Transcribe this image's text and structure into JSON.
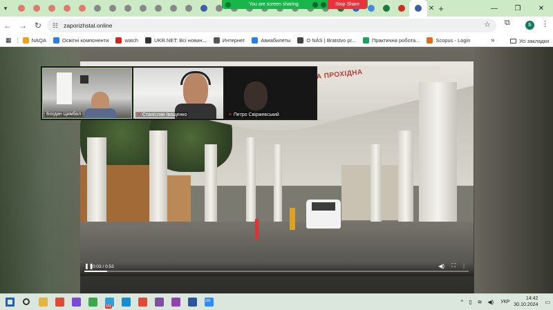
{
  "browser": {
    "tab_count": 28,
    "new_tab_symbol": "+",
    "close_symbol": "✕",
    "window_controls": [
      "—",
      "❐",
      "✕"
    ],
    "tab_colors": [
      "#e07a6a",
      "#e07a6a",
      "#e07a6a",
      "#e07a6a",
      "#e07a6a",
      "#888888",
      "#888888",
      "#888888",
      "#888888",
      "#888888",
      "#888888",
      "#888888",
      "#3d5fa8",
      "#888888",
      "#888888",
      "#888888",
      "#888888",
      "#888888",
      "#888888",
      "#888888",
      "#888888",
      "#1e7a3c",
      "#1f6fd1",
      "#4a8bd8",
      "#1e7a3c",
      "#c8331f",
      "#3a5ea8"
    ]
  },
  "share_banner": {
    "text": "You are screen sharing",
    "stop_label": "Stop Share"
  },
  "toolbar": {
    "url": "zaporizhstal.online",
    "profile_letter": "Б"
  },
  "bookmarks": {
    "items": [
      {
        "label": "NAQA",
        "icon_color": "#f0a020"
      },
      {
        "label": "Освітні компоненти",
        "icon_color": "#2a7de1"
      },
      {
        "label": "watch",
        "icon_color": "#e02020"
      },
      {
        "label": "UKR.NET: Всі новин...",
        "icon_color": "#333333"
      },
      {
        "label": "Интернет",
        "icon_color": "#555555"
      },
      {
        "label": "Авиабилеты",
        "icon_color": "#2a7de1"
      },
      {
        "label": "О NÁS | Bratstvo pr...",
        "icon_color": "#444444"
      },
      {
        "label": "Практична робота...",
        "icon_color": "#1aa260"
      },
      {
        "label": "Scopus - Login",
        "icon_color": "#e46b1c"
      }
    ],
    "folder_label": "Усі закладки"
  },
  "video": {
    "time": "0:03 / 0:53",
    "progress": 0.06,
    "sign_text": "НА ПРОХІДНА"
  },
  "participants": [
    {
      "name": "Богдан Цимбал"
    },
    {
      "name": "Станіслав Іващенко"
    },
    {
      "name": "Петро Свіржевський"
    }
  ],
  "taskbar": {
    "apps": [
      {
        "name": "windows-start-icon",
        "color": "#1f5fb5"
      },
      {
        "name": "search-icon",
        "color": "#333333"
      },
      {
        "name": "file-explorer-icon",
        "color": "#e2b441"
      },
      {
        "name": "chrome-icon",
        "color": "#dd4b39"
      },
      {
        "name": "media-icon",
        "color": "#7a4bd6"
      },
      {
        "name": "download-icon",
        "color": "#3aa74a"
      },
      {
        "name": "telegram-icon",
        "color": "#2aa1da"
      },
      {
        "name": "edge-icon",
        "color": "#1b8bd1"
      },
      {
        "name": "chrome-active-icon",
        "color": "#dd4b39"
      },
      {
        "name": "viber-icon",
        "color": "#7b519d"
      },
      {
        "name": "app-purple-icon",
        "color": "#8e44ad"
      },
      {
        "name": "notes-icon",
        "color": "#2b579a"
      },
      {
        "name": "zoom-icon",
        "color": "#2d8cff"
      }
    ],
    "telegram_badge": "431",
    "zoom_label": "zm",
    "language": "УКР",
    "time": "14:42",
    "date": "30.10.2024"
  }
}
